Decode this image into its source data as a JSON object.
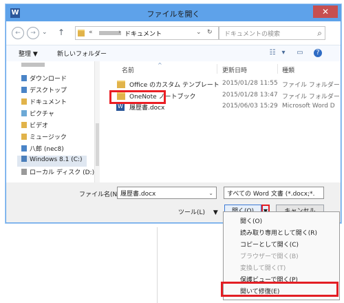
{
  "dialog": {
    "title": "ファイルを開く",
    "app_icon": "W",
    "close_glyph": "✕",
    "address_chevron": "«",
    "address_separator": "›",
    "location": "ドキュメント",
    "search_placeholder": "ドキュメントの検索"
  },
  "toolbar": {
    "organize": "整理 ▼",
    "new_folder": "新しいフォルダー"
  },
  "sidebar": {
    "items": [
      {
        "label": "ダウンロード"
      },
      {
        "label": "デスクトップ"
      },
      {
        "label": "ドキュメント"
      },
      {
        "label": "ピクチャ"
      },
      {
        "label": "ビデオ"
      },
      {
        "label": "ミュージック"
      },
      {
        "label": "八郎 (nec8)"
      },
      {
        "label": "Windows 8.1 (C:)"
      },
      {
        "label": "ローカル ディスク (D:)"
      }
    ]
  },
  "file_list": {
    "headers": {
      "name": "名前",
      "date": "更新日時",
      "type": "種類"
    },
    "rows": [
      {
        "name": "Office のカスタム テンプレート",
        "date": "2015/01/28 11:55",
        "type": "ファイル フォルダー"
      },
      {
        "name": "OneNote ノートブック",
        "date": "2015/01/28 13:47",
        "type": "ファイル フォルダー"
      },
      {
        "name": "履歴書.docx",
        "date": "2015/06/03 15:29",
        "type": "Microsoft Word D"
      }
    ]
  },
  "bottom": {
    "filename_label": "ファイル名(N):",
    "filename_value": "履歴書.docx",
    "filetype_value": "すべての Word 文書 (*.docx;*.",
    "tools_label": "ツール(L)",
    "tools_arrow": "▼",
    "open_label": "開く(O)",
    "cancel_label": "キャンセル"
  },
  "menu": {
    "items": [
      {
        "label": "開く(O)",
        "enabled": true
      },
      {
        "label": "読み取り専用として開く(R)",
        "enabled": true
      },
      {
        "label": "コピーとして開く(C)",
        "enabled": true
      },
      {
        "label": "ブラウザーで開く(B)",
        "enabled": false
      },
      {
        "label": "変換して開く(T)",
        "enabled": false
      },
      {
        "label": "保護ビューで開く(P)",
        "enabled": true
      },
      {
        "label": "開いて修復(E)",
        "enabled": true
      }
    ]
  },
  "colors": {
    "titlebar": "#5ea2ea",
    "highlight": "#e31e24",
    "word_blue": "#2b579a"
  }
}
